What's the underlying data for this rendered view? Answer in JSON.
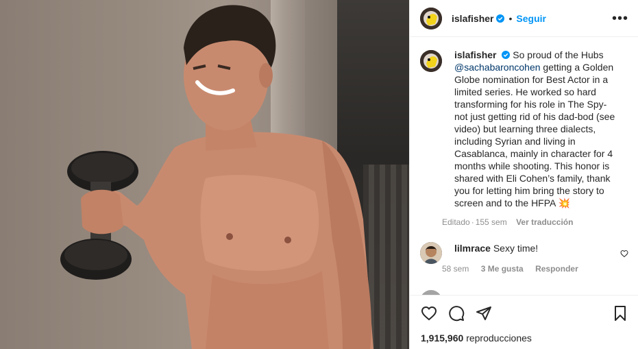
{
  "post": {
    "username": "islafisher",
    "follow_label": "Seguir",
    "more_label": "•••",
    "caption_parts": {
      "before_mention": "So proud of the Hubs",
      "mention": "@sachabaroncohen",
      "after_mention": "getting a Golden Globe nomination for Best Actor in a limited series. He worked so hard transforming for his role in The Spy- not just getting rid of his dad-bod (see video) but learning three dialects, including Syrian and living in Casablanca, mainly in character for 4 months while shooting. This honor is shared with Eli Cohen’s family, thank you for letting him bring the story to screen and to the HFPA",
      "emoji": "💥"
    },
    "caption_meta": {
      "edited": "Editado",
      "time": "155 sem",
      "translate": "Ver traducción"
    }
  },
  "comments": [
    {
      "username": "lilmrace",
      "text": "Sexy time!",
      "time": "58 sem",
      "likes": "3 Me gusta",
      "reply_label": "Responder"
    },
    {
      "username": "",
      "text": ""
    }
  ],
  "footer": {
    "views_count": "1,915,960",
    "views_label": "reproducciones"
  },
  "icons": {
    "like": "heart-icon",
    "comment": "comment-icon",
    "share": "share-icon",
    "save": "bookmark-icon",
    "verified": "verified-badge-icon"
  },
  "colors": {
    "link": "#0095f6",
    "mention": "#00376b",
    "muted": "#8e8e8e",
    "border": "#efefef"
  }
}
